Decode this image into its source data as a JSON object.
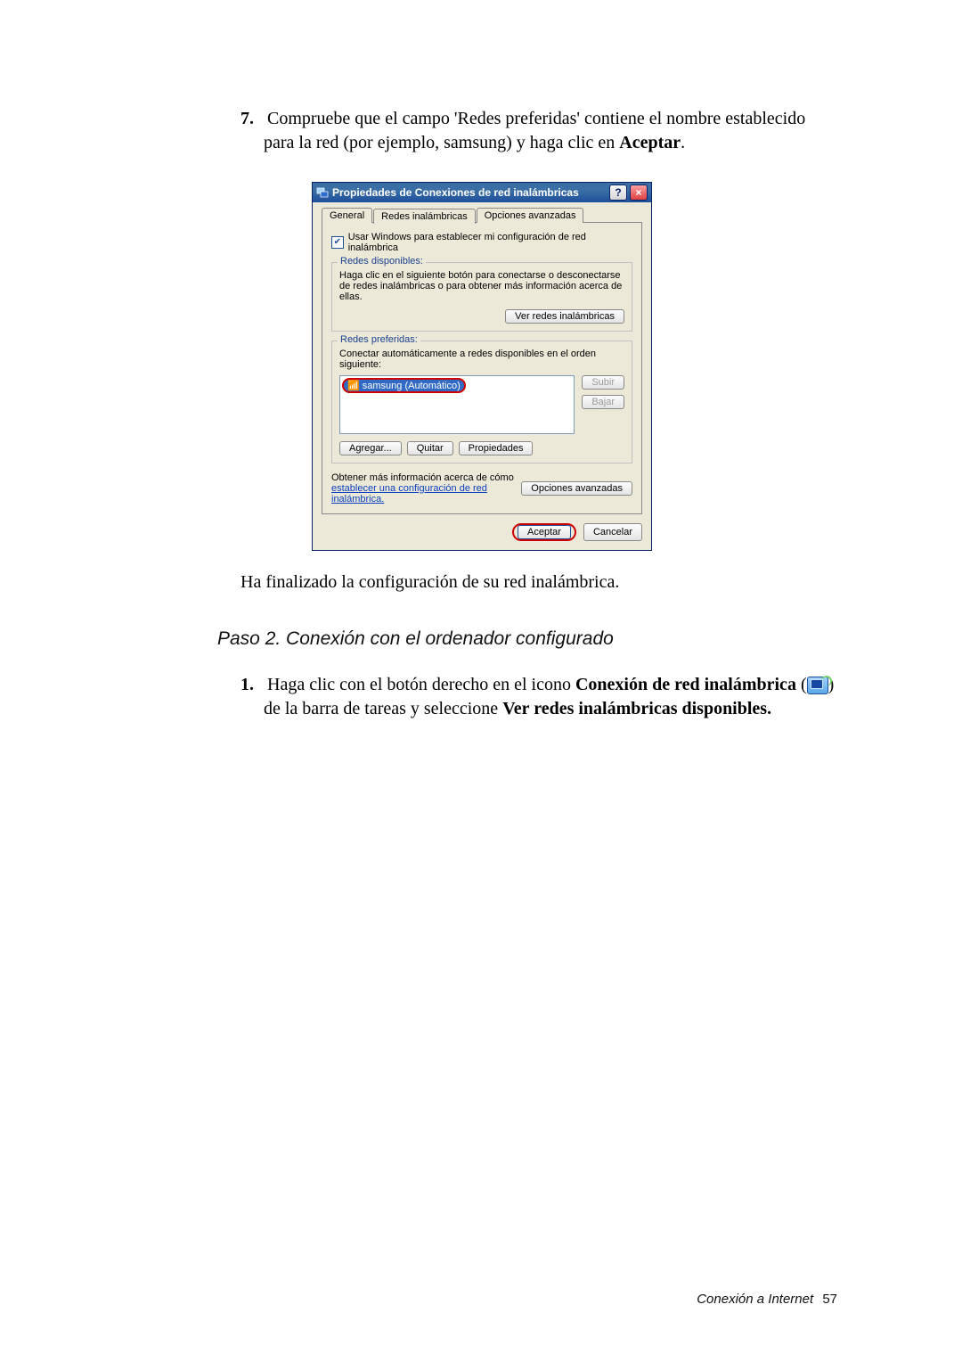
{
  "step7": {
    "num": "7.",
    "text_before_bold": "Compruebe que el campo 'Redes preferidas' contiene el nombre establecido para la red (por ejemplo, samsung) y haga clic en ",
    "bold": "Aceptar",
    "after": "."
  },
  "dialog": {
    "title": "Propiedades de Conexiones de red inalámbricas",
    "help_btn": "?",
    "close_btn": "×",
    "tabs": {
      "general": "General",
      "wireless": "Redes inalámbricas",
      "advanced": "Opciones avanzadas"
    },
    "use_windows_label": "Usar Windows para establecer mi configuración de red inalámbrica",
    "group_available": {
      "label": "Redes disponibles:",
      "desc": "Haga clic en el siguiente botón para conectarse o desconectarse de redes inalámbricas o para obtener más información acerca de ellas.",
      "view_btn": "Ver redes inalámbricas"
    },
    "group_preferred": {
      "label": "Redes preferidas:",
      "desc": "Conectar automáticamente a redes disponibles en el orden siguiente:",
      "item": "samsung (Automático)",
      "up": "Subir",
      "down": "Bajar",
      "add": "Agregar...",
      "remove": "Quitar",
      "props": "Propiedades"
    },
    "more_info_pre": "Obtener más información acerca de cómo ",
    "more_info_link": "establecer una configuración de red inalámbrica.",
    "adv_opts": "Opciones avanzadas",
    "ok": "Aceptar",
    "cancel": "Cancelar"
  },
  "finished": "Ha finalizado la configuración de su red inalámbrica.",
  "step2_heading": "Paso 2. Conexión con el ordenador configurado",
  "step1": {
    "num": "1.",
    "t1": "Haga clic con el botón derecho en el icono ",
    "b1": "Conexión de red inalámbrica",
    "paren_open": " (",
    "paren_close": ") ",
    "t2": "de la barra de tareas y seleccione ",
    "b2": "Ver redes inalámbricas disponibles."
  },
  "footer": {
    "section": "Conexión a Internet",
    "page": "57"
  }
}
